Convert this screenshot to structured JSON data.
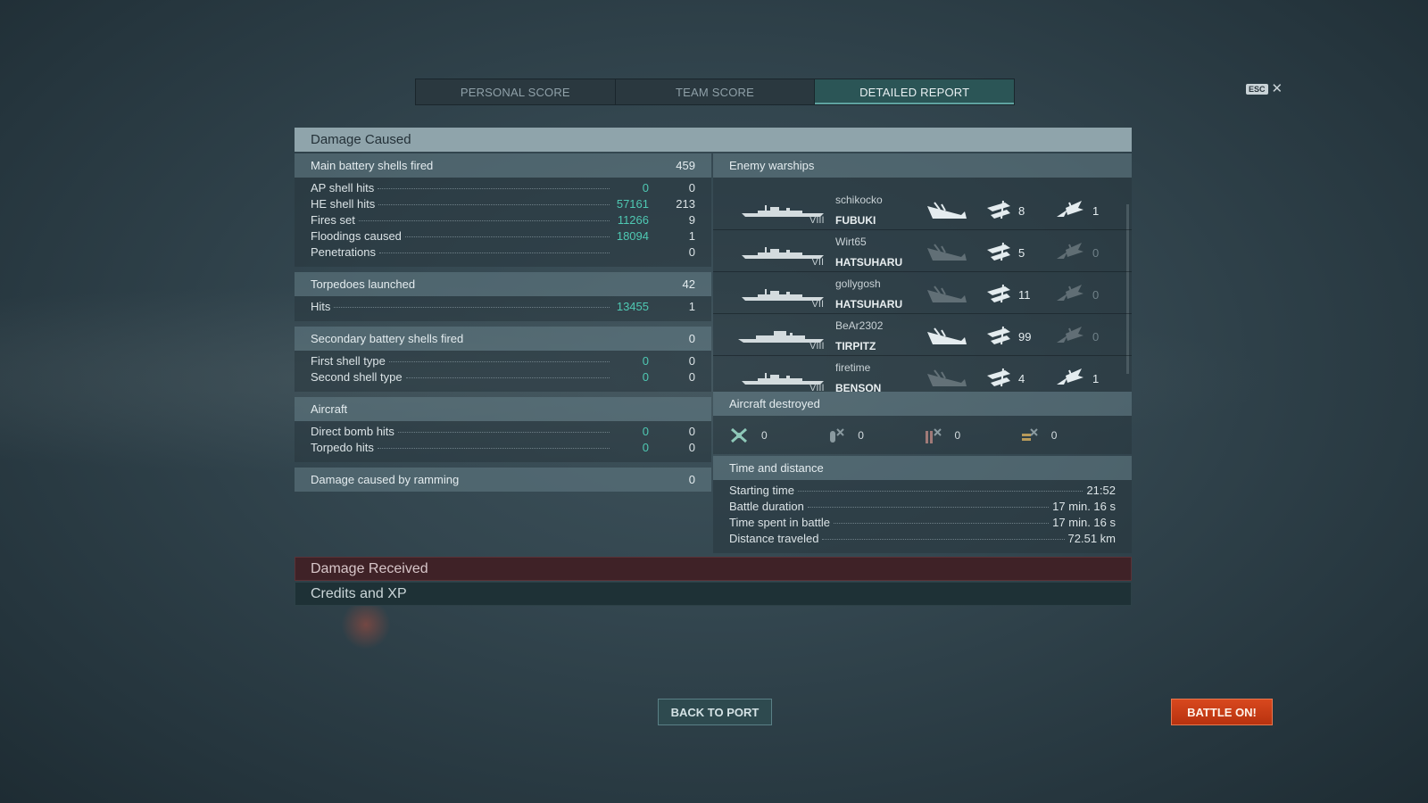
{
  "tabs": [
    {
      "label": "PERSONAL SCORE",
      "active": false
    },
    {
      "label": "TEAM SCORE",
      "active": false
    },
    {
      "label": "DETAILED REPORT",
      "active": true
    }
  ],
  "esc": {
    "key": "ESC",
    "close": "✕"
  },
  "damage_caused": {
    "title": "Damage Caused",
    "main_battery": {
      "label": "Main battery shells fired",
      "value": "459",
      "rows": [
        {
          "label": "AP shell hits",
          "damage": "0",
          "count": "0"
        },
        {
          "label": "HE shell hits",
          "damage": "57161",
          "count": "213"
        },
        {
          "label": "Fires set",
          "damage": "11266",
          "count": "9"
        },
        {
          "label": "Floodings caused",
          "damage": "18094",
          "count": "1"
        },
        {
          "label": "Penetrations",
          "damage": "",
          "count": "0"
        }
      ]
    },
    "torpedoes": {
      "label": "Torpedoes launched",
      "value": "42",
      "rows": [
        {
          "label": "Hits",
          "damage": "13455",
          "count": "1"
        }
      ]
    },
    "secondary": {
      "label": "Secondary battery shells fired",
      "value": "0",
      "rows": [
        {
          "label": "First shell type",
          "damage": "0",
          "count": "0"
        },
        {
          "label": "Second shell type",
          "damage": "0",
          "count": "0"
        }
      ]
    },
    "aircraft": {
      "label": "Aircraft",
      "rows": [
        {
          "label": "Direct bomb hits",
          "damage": "0",
          "count": "0"
        },
        {
          "label": "Torpedo hits",
          "damage": "0",
          "count": "0"
        }
      ]
    },
    "ramming": {
      "label": "Damage caused by ramming",
      "value": "0"
    }
  },
  "enemy_warships": {
    "label": "Enemy warships",
    "ships": [
      {
        "player": "schikocko",
        "name": "FUBUKI",
        "tier": "VIII",
        "class": "destroyer",
        "destroyed": true,
        "hits": "8",
        "hits_active": true,
        "torp": "1",
        "torp_active": true
      },
      {
        "player": "Wirt65",
        "name": "HATSUHARU",
        "tier": "VII",
        "class": "destroyer",
        "destroyed": false,
        "hits": "5",
        "hits_active": true,
        "torp": "0",
        "torp_active": false
      },
      {
        "player": "gollygosh",
        "name": "HATSUHARU",
        "tier": "VII",
        "class": "destroyer",
        "destroyed": false,
        "hits": "11",
        "hits_active": true,
        "torp": "0",
        "torp_active": false
      },
      {
        "player": "BeAr2302",
        "name": "TIRPITZ",
        "tier": "VIII",
        "class": "battleship",
        "destroyed": true,
        "hits": "99",
        "hits_active": true,
        "torp": "0",
        "torp_active": false
      },
      {
        "player": "firetime",
        "name": "BENSON",
        "tier": "VIII",
        "class": "destroyer",
        "destroyed": false,
        "hits": "4",
        "hits_active": true,
        "torp": "1",
        "torp_active": true
      }
    ]
  },
  "aircraft_destroyed": {
    "label": "Aircraft destroyed",
    "items": [
      {
        "icon": "fighter-plane-icon",
        "value": "0"
      },
      {
        "icon": "bomber-icon",
        "value": "0"
      },
      {
        "icon": "torpedo-bomber-icon",
        "value": "0"
      },
      {
        "icon": "spotter-plane-icon",
        "value": "0"
      }
    ]
  },
  "time_distance": {
    "label": "Time and distance",
    "rows": [
      {
        "label": "Starting time",
        "value": "21:52"
      },
      {
        "label": "Battle duration",
        "value": "17 min. 16 s"
      },
      {
        "label": "Time spent in battle",
        "value": "17 min. 16 s"
      },
      {
        "label": "Distance traveled",
        "value": "72.51 km"
      }
    ]
  },
  "sections": {
    "damage_received": "Damage Received",
    "credits_xp": "Credits and XP"
  },
  "buttons": {
    "back": "BACK TO PORT",
    "battle": "BATTLE ON!"
  },
  "colors": {
    "damage": "#4fc9b3",
    "battle_button": "#c93d14",
    "active_tab": "#2b5556"
  }
}
